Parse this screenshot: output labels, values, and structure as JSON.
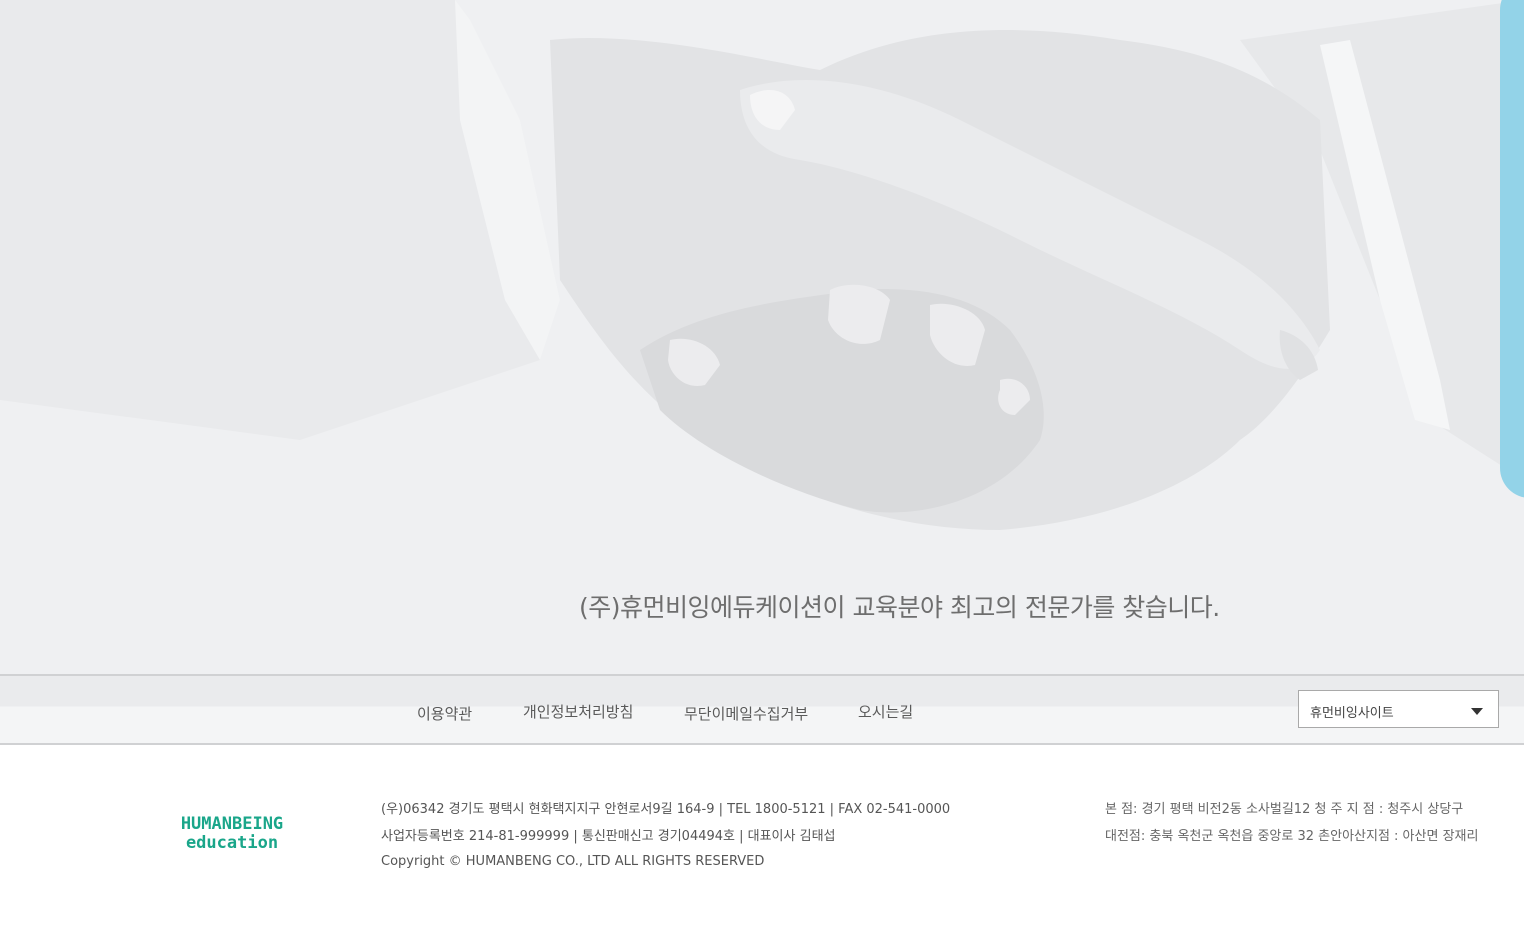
{
  "hero": {
    "tagline": "(주)휴먼비잉에듀케이션이 교육분야 최고의 전문가를 찾습니다."
  },
  "nav": {
    "links": [
      "이용약관",
      "개인정보처리방침",
      "무단이메일수집거부",
      "오시는길"
    ],
    "site_select": {
      "selected": "휴먼비잉사이트",
      "icon": "chevron-down-icon"
    }
  },
  "footer": {
    "logo": {
      "line1": "HUMANBEING",
      "line2": "education",
      "color": "#1aa68a"
    },
    "address_line": "(우)06342 경기도 평택시 현화택지지구 안현로서9길 164-9  |  TEL 1800-5121  |   FAX 02-541-0000",
    "registration_line": "사업자등록번호 214-81-999999 | 통신판매신고 경기04494호 | 대표이사 김태섭",
    "copyright": "Copyright © HUMANBENG CO., LTD ALL RIGHTS RESERVED",
    "branches": [
      "본   점: 경기 평택 비전2동 소사벌길12     청  주  지  점  : 청주시 상당구",
      "대전점: 충북 옥천군 옥천읍 중앙로 32     촌안아산지점 : 아산면 장재리"
    ]
  },
  "colors": {
    "hero_bg": "#eff0f2",
    "accent_tab": "#93d3e8",
    "logo_green": "#1aa68a"
  }
}
